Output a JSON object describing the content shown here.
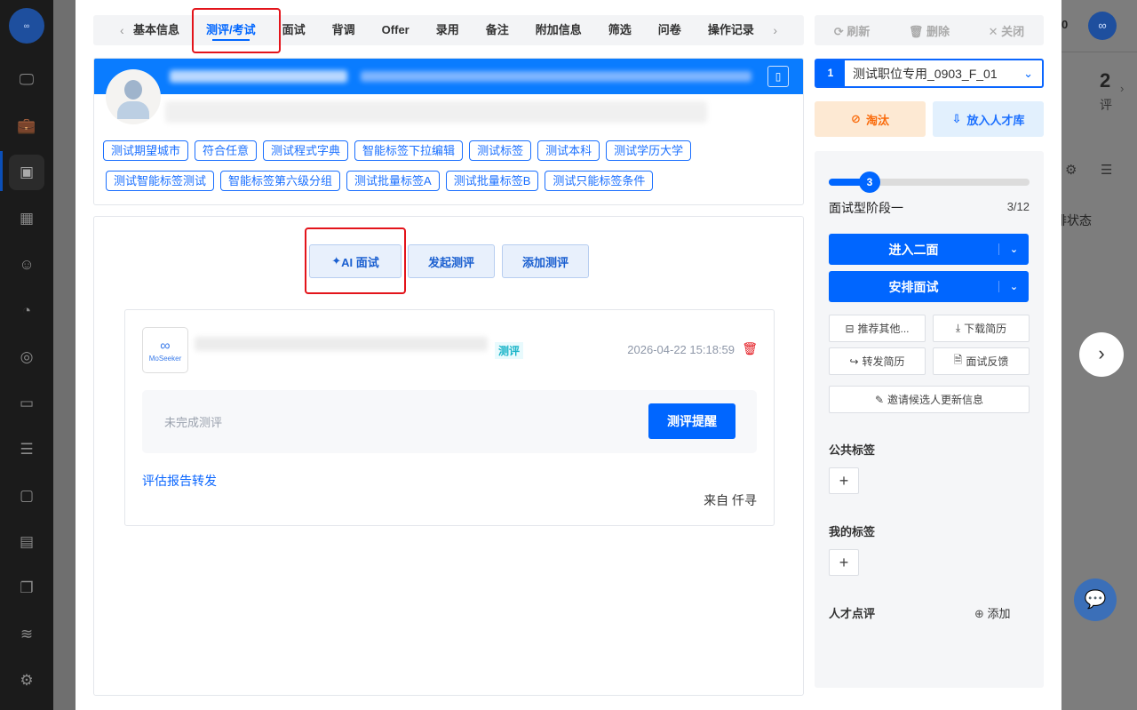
{
  "tabs": {
    "items": [
      "基本信息",
      "测评/考试",
      "面试",
      "背调",
      "Offer",
      "录用",
      "备注",
      "附加信息",
      "筛选",
      "问卷",
      "操作记录"
    ],
    "active": "测评/考试"
  },
  "tags": {
    "row1": [
      "测试期望城市",
      "符合任意",
      "测试程式字典",
      "智能标签下拉编辑",
      "测试标签",
      "测试本科",
      "测试学历大学"
    ],
    "row2": [
      "测试智能标签测试",
      "智能标签第六级分组",
      "测试批量标签A",
      "测试批量标签B",
      "测试只能标签条件"
    ]
  },
  "assessment": {
    "ai_interview": "AI 面试",
    "start_assessment": "发起测评",
    "add_assessment": "添加测评",
    "item": {
      "badge": "测评",
      "datetime": "2026-04-22 15:18:59",
      "status": "未完成测评",
      "remind_button": "测评提醒",
      "forward_link": "评估报告转发",
      "source": "来自 仟寻",
      "logo_text": "MoSeeker"
    }
  },
  "right": {
    "toolbar": {
      "refresh": "刷新",
      "delete": "删除",
      "close": "关闭"
    },
    "position": {
      "index": "1",
      "name": "测试职位专用_0903_F_01"
    },
    "eliminate": "淘汰",
    "talent_pool": "放入人才库",
    "stage": {
      "current": "3",
      "name": "面试型阶段一",
      "progress": "3/12",
      "fraction": 0.1818
    },
    "next_round": "进入二面",
    "schedule": "安排面试",
    "actions": [
      "推荐其他...",
      "下载简历",
      "转发简历",
      "面试反馈"
    ],
    "invite": "邀请候选人更新信息",
    "public_tags": "公共标签",
    "my_tags": "我的标签",
    "talent_review": "人才点评",
    "add": "添加"
  },
  "background": {
    "count": "2",
    "count_label": "评",
    "status_label": "排状态",
    "badge": "0"
  },
  "colors": {
    "primary": "#0066ff",
    "danger": "#e3141b",
    "header": "#0a7cff"
  }
}
